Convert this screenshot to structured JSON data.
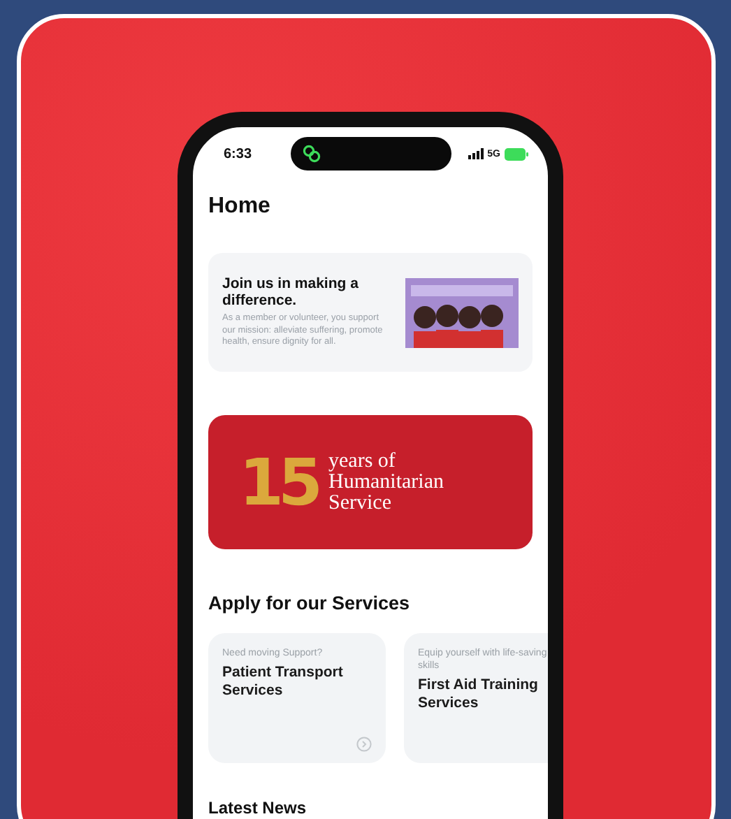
{
  "status_bar": {
    "time": "6:33",
    "network": "5G"
  },
  "title": "Home",
  "join_card": {
    "heading": "Join us in making a difference.",
    "body": "As a member or volunteer, you support our mission: alleviate suffering, promote health, ensure dignity for all."
  },
  "banner": {
    "number": "15",
    "text": "years of Humanitarian Service"
  },
  "services": {
    "heading": "Apply for our Services",
    "items": [
      {
        "subtitle": "Need moving Support?",
        "title": "Patient Transport Services"
      },
      {
        "subtitle": "Equip yourself with life-saving skills",
        "title": "First Aid Training Services"
      }
    ]
  },
  "latest_news": {
    "heading": "Latest News"
  }
}
